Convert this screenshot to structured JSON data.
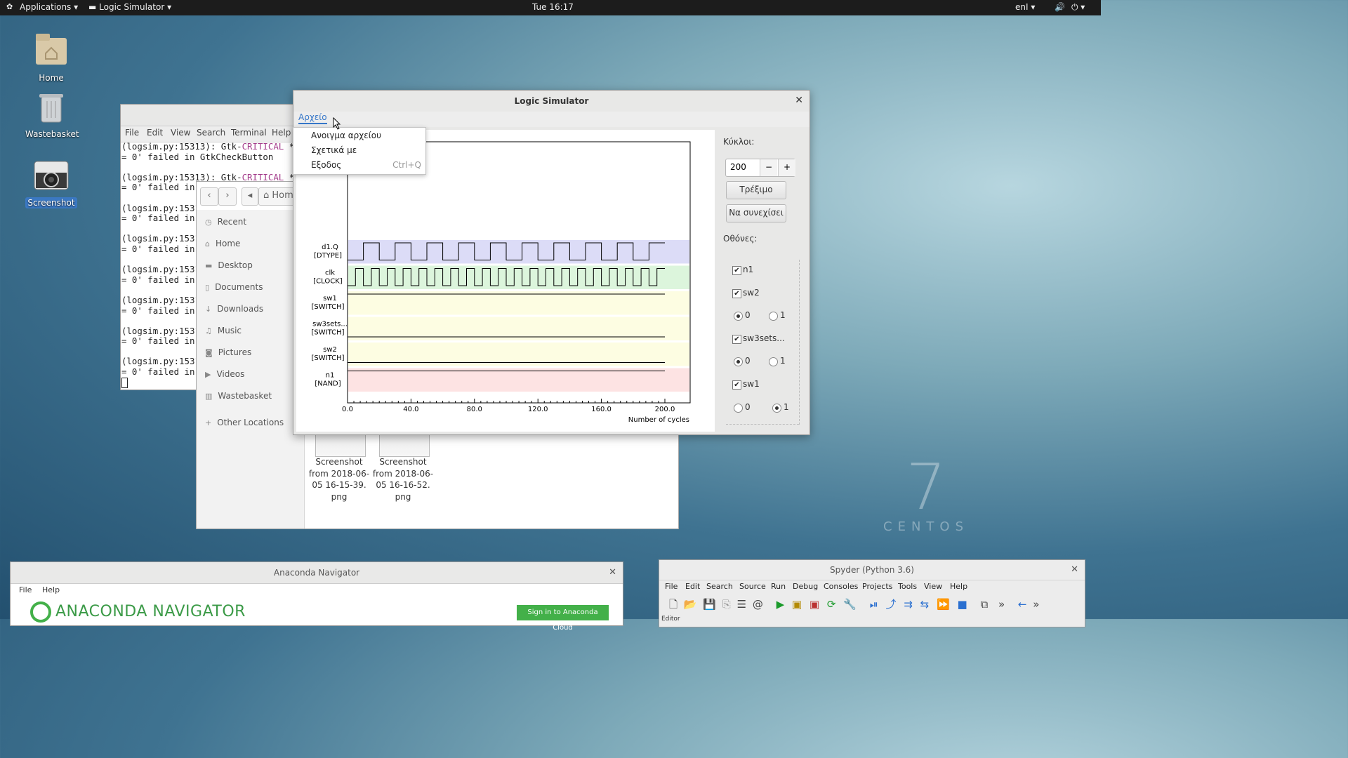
{
  "topbar": {
    "applications": "Applications",
    "app_name": "Logic Simulator",
    "clock": "Tue 16:17",
    "lang": "enΙ"
  },
  "desktop": {
    "icons": [
      {
        "label": "Home"
      },
      {
        "label": "Wastebasket"
      },
      {
        "label": "Screenshot"
      }
    ],
    "watermark_num": "7",
    "watermark_text": "CENTOS"
  },
  "terminal": {
    "menu": [
      "File",
      "Edit",
      "View",
      "Search",
      "Terminal",
      "Help"
    ],
    "lines": [
      {
        "a": "(logsim.py:15313): Gtk-",
        "crit": "CRITICAL",
        "b": " **"
      },
      {
        "a": "= 0' failed in GtkCheckButton",
        "crit": "",
        "b": ""
      },
      {
        "a": "",
        "crit": "",
        "b": ""
      },
      {
        "a": "(logsim.py:15313): Gtk-",
        "crit": "CRITICAL",
        "b": " **"
      },
      {
        "a": "= 0' failed in",
        "crit": "",
        "b": ""
      },
      {
        "a": "",
        "crit": "",
        "b": ""
      },
      {
        "a": "(logsim.py:1531",
        "crit": "",
        "b": ""
      },
      {
        "a": "= 0' failed in",
        "crit": "",
        "b": ""
      },
      {
        "a": "",
        "crit": "",
        "b": ""
      },
      {
        "a": "(logsim.py:1531",
        "crit": "",
        "b": ""
      },
      {
        "a": "= 0' failed in",
        "crit": "",
        "b": ""
      },
      {
        "a": "",
        "crit": "",
        "b": ""
      },
      {
        "a": "(logsim.py:1531",
        "crit": "",
        "b": ""
      },
      {
        "a": "= 0' failed in",
        "crit": "",
        "b": ""
      },
      {
        "a": "",
        "crit": "",
        "b": ""
      },
      {
        "a": "(logsim.py:1531",
        "crit": "",
        "b": ""
      },
      {
        "a": "= 0' failed in",
        "crit": "",
        "b": ""
      },
      {
        "a": "",
        "crit": "",
        "b": ""
      },
      {
        "a": "(logsim.py:1531",
        "crit": "",
        "b": ""
      },
      {
        "a": "= 0' failed in",
        "crit": "",
        "b": ""
      },
      {
        "a": "",
        "crit": "",
        "b": ""
      },
      {
        "a": "(logsim.py:1531",
        "crit": "",
        "b": ""
      },
      {
        "a": "= 0' failed in",
        "crit": "",
        "b": ""
      }
    ]
  },
  "filemanager": {
    "path": "Home",
    "sidebar": [
      "Recent",
      "Home",
      "Desktop",
      "Documents",
      "Downloads",
      "Music",
      "Pictures",
      "Videos",
      "Wastebasket",
      "Other Locations"
    ],
    "files": [
      {
        "l1": "Screenshot",
        "l2": "from 2018-06-",
        "l3": "05 16-15-39.",
        "l4": "png"
      },
      {
        "l1": "Screenshot",
        "l2": "from 2018-06-",
        "l3": "05 16-16-52.",
        "l4": "png"
      }
    ]
  },
  "logicsim": {
    "title": "Logic Simulator",
    "menu_file": "Αρχείο",
    "dropdown": [
      {
        "label": "Ανοιγμα αρχείου",
        "shortcut": ""
      },
      {
        "label": "Σχετικά με",
        "shortcut": ""
      },
      {
        "label": "Εξοδος",
        "shortcut": "Ctrl+Q"
      }
    ],
    "cycles_label": "Κύκλοι:",
    "cycles_value": "200",
    "run_label": "Τρέξιμο",
    "continue_label": "Να συνεχίσει",
    "monitors_label": "Οθόνες:",
    "monitors": [
      {
        "name": "n1",
        "checked": true,
        "switch": null
      },
      {
        "name": "sw2",
        "checked": true,
        "switch": 0
      },
      {
        "name": "sw3sets...",
        "checked": true,
        "switch": 0
      },
      {
        "name": "sw1",
        "checked": true,
        "switch": 1
      }
    ],
    "radio_labels": [
      "0",
      "1"
    ]
  },
  "chart_data": {
    "type": "line",
    "title": "",
    "xlabel": "Number of cycles",
    "ylabel": "",
    "xlim": [
      0,
      200
    ],
    "xticks": [
      "0.0",
      "40.0",
      "80.0",
      "120.0",
      "160.0",
      "200.0"
    ],
    "signals": [
      {
        "name": "d1.Q",
        "dev": "[DTYPE]",
        "kind": "square",
        "period": 20,
        "color": "#dcdcf7"
      },
      {
        "name": "clk",
        "dev": "[CLOCK]",
        "kind": "square",
        "period": 10,
        "color": "#dcf5dc"
      },
      {
        "name": "sw1",
        "dev": "[SWITCH]",
        "kind": "const",
        "level": 1,
        "color": "#fdfde2"
      },
      {
        "name": "sw3sets...",
        "dev": "[SWITCH]",
        "kind": "const",
        "level": 0,
        "color": "#fdfde2"
      },
      {
        "name": "sw2",
        "dev": "[SWITCH]",
        "kind": "const",
        "level": 0,
        "color": "#fdfde2"
      },
      {
        "name": "n1",
        "dev": "[NAND]",
        "kind": "const",
        "level": 1,
        "color": "#fde3e3"
      }
    ]
  },
  "anaconda": {
    "title": "Anaconda Navigator",
    "menu": [
      "File",
      "Help"
    ],
    "logo": "ANACONDA NAVIGATOR",
    "signin": "Sign in to Anaconda Cloud"
  },
  "spyder": {
    "title": "Spyder (Python 3.6)",
    "menu": [
      "File",
      "Edit",
      "Search",
      "Source",
      "Run",
      "Debug",
      "Consoles",
      "Projects",
      "Tools",
      "View",
      "Help"
    ],
    "editor_label": "Editor"
  }
}
